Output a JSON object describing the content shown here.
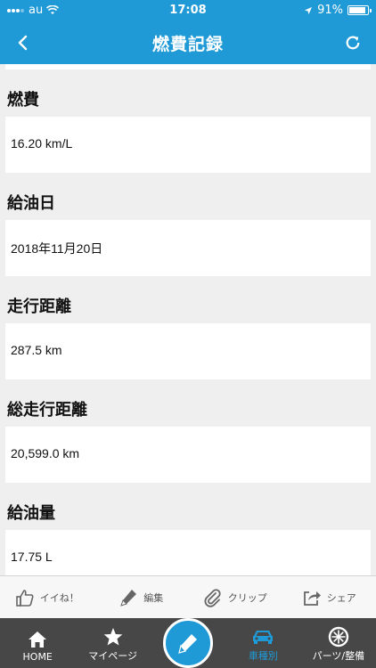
{
  "status_bar": {
    "carrier": "au",
    "time": "17:08",
    "battery": "91%",
    "battery_level": 0.91
  },
  "header": {
    "title": "燃費記録",
    "back_icon": "chevron-left-icon",
    "refresh_icon": "refresh-icon"
  },
  "fields": [
    {
      "label": "燃費",
      "value": "16.20 km/L"
    },
    {
      "label": "給油日",
      "value": "2018年11月20日"
    },
    {
      "label": "走行距離",
      "value": "287.5 km"
    },
    {
      "label": "総走行距離",
      "value": "20,599.0 km"
    },
    {
      "label": "給油量",
      "value": "17.75 L"
    }
  ],
  "actions": [
    {
      "label": "イイね！",
      "icon": "thumbs-up-icon"
    },
    {
      "label": "編集",
      "icon": "pen-icon"
    },
    {
      "label": "クリップ",
      "icon": "paperclip-icon"
    },
    {
      "label": "シェア",
      "icon": "share-icon"
    }
  ],
  "tabs": [
    {
      "label": "HOME",
      "icon": "home-icon"
    },
    {
      "label": "マイページ",
      "icon": "star-icon"
    },
    {
      "label": "",
      "icon": "pen-icon"
    },
    {
      "label": "車種別",
      "icon": "car-icon"
    },
    {
      "label": "パーツ/整備",
      "icon": "tire-icon"
    }
  ],
  "colors": {
    "accent": "#1f9ad6",
    "tab_bar": "#474747",
    "background": "#efefef"
  }
}
